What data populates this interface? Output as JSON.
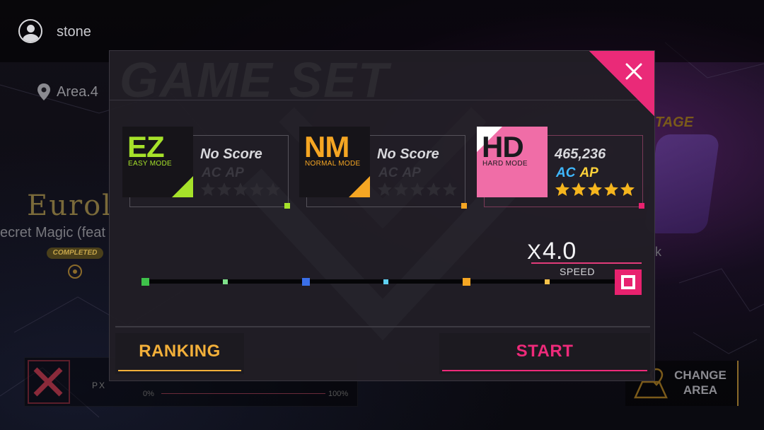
{
  "colors": {
    "ez": "#a6e22a",
    "nm": "#f5a623",
    "hd": "#f06da7",
    "ac_gray": "#3a3840",
    "ac_blue": "#3fb8ff",
    "ap_yellow": "#ffd23a",
    "star_gold": "#f5b51e",
    "star_gray": "#2e2c33",
    "accent_pink": "#ea2a78",
    "ranking_gold": "#f3b03a"
  },
  "topbar": {
    "username": "stone",
    "avatar_icon": "user-avatar-icon"
  },
  "background": {
    "area_label": "Area.4",
    "song_logo": "Eurol",
    "song_title": "ecret Magic (feat",
    "completed_badge": "COMPLETED",
    "stage_label": "TAGE",
    "side_letter": "k",
    "progress_start": "0%",
    "progress_end": "100%",
    "brand_text": "PX",
    "change_area": [
      "CHANGE",
      "AREA"
    ]
  },
  "dialog": {
    "title": "GAME SET",
    "close_icon": "close-icon",
    "modes": [
      {
        "key": "ez",
        "abbr": "EZ",
        "name": "EASY MODE",
        "score": "No Score",
        "ac": "AC",
        "ap": "AP",
        "ac_color": "#3a3840",
        "ap_color": "#3a3840",
        "stars_filled": 0,
        "stars_total": 5,
        "selected": false
      },
      {
        "key": "nm",
        "abbr": "NM",
        "name": "NORMAL MODE",
        "score": "No Score",
        "ac": "AC",
        "ap": "AP",
        "ac_color": "#3a3840",
        "ap_color": "#3a3840",
        "stars_filled": 0,
        "stars_total": 5,
        "selected": false
      },
      {
        "key": "hd",
        "abbr": "HD",
        "name": "HARD MODE",
        "score": "465,236",
        "ac": "AC",
        "ap": "AP",
        "ac_color": "#3fb8ff",
        "ap_color": "#ffd23a",
        "stars_filled": 5,
        "stars_total": 5,
        "selected": true
      }
    ],
    "speed": {
      "prefix": "X",
      "value": "4.0",
      "label": "SPEED",
      "ticks": [
        {
          "color": "#3ec24a",
          "size": "big"
        },
        {
          "color": "#7ee08a",
          "size": "small"
        },
        {
          "color": "#3a6fe8",
          "size": "big"
        },
        {
          "color": "#5ecff0",
          "size": "small"
        },
        {
          "color": "#f5a623",
          "size": "big"
        },
        {
          "color": "#f7c24a",
          "size": "small"
        }
      ]
    },
    "buttons": {
      "ranking": "RANKING",
      "start": "START"
    }
  }
}
